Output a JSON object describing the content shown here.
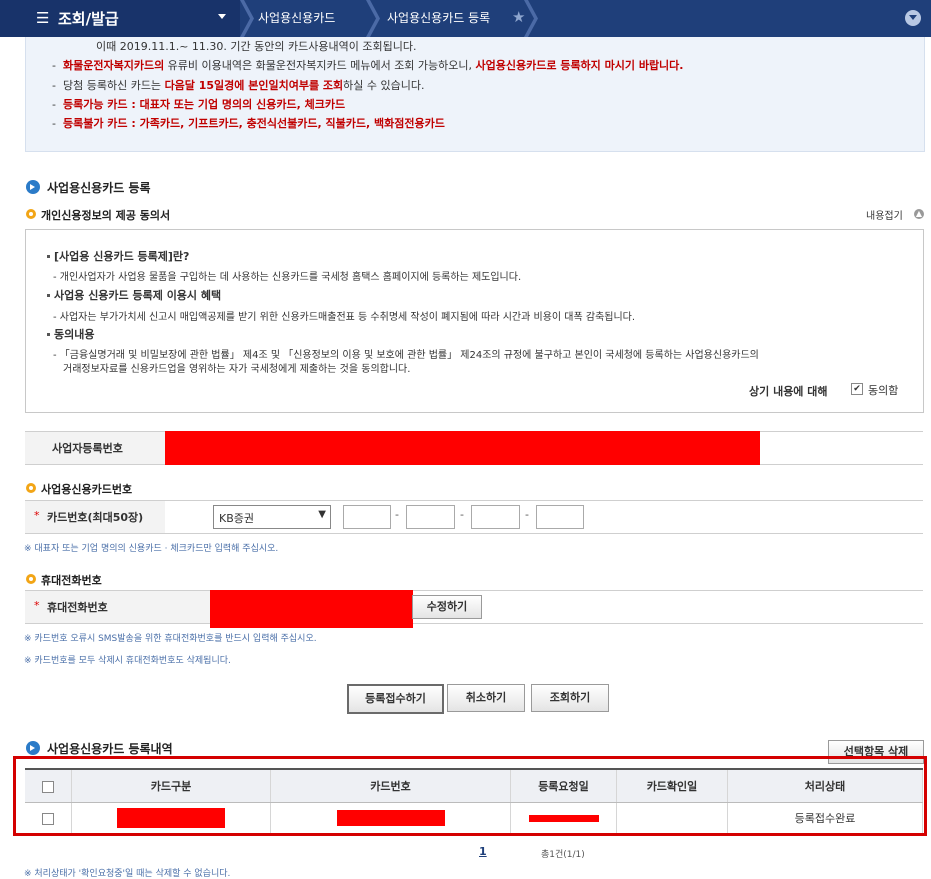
{
  "nav": {
    "menu_label": "조회/발급",
    "breadcrumb_1": "사업용신용카드",
    "breadcrumb_2": "사업용신용카드 등록",
    "star": "★"
  },
  "info": {
    "line0": "이때 2019.11.1.~ 11.30. 기간 동안의 카드사용내역이 조회됩니다.",
    "line1_red_a": "화물운전자복지카드의",
    "line1_mid": " 유류비 이용내역은 화물운전자복지카드 메뉴에서 조회 가능하오니, ",
    "line1_red_b": "사업용신용카드로 등록하지 마시기 바랍니다.",
    "line2_a": "당첨 등록하신 카드는 ",
    "line2_red": "다음달 15일경에 본인일치여부를 조회",
    "line2_b": "하실 수 있습니다.",
    "line3": "등록가능 카드 : 대표자 또는 기업 명의의 신용카드, 체크카드",
    "line4": "등록불가 카드 : 가족카드, 기프트카드, 충전식선불카드, 직불카드, 백화점전용카드",
    "dash": "-"
  },
  "register": {
    "section_title": "사업용신용카드 등록",
    "consent_title": "개인신용정보의 제공 동의서",
    "collapse_label": "내용접기",
    "h1": "[사업용 신용카드 등록제]란?",
    "p1": "- 개인사업자가 사업용 물품을 구입하는 데 사용하는 신용카드를 국세청 홈택스 홈페이지에 등록하는 제도입니다.",
    "h2": "사업용 신용카드 등록제 이용시 혜택",
    "p2": "- 사업자는 부가가치세 신고시 매입액공제를 받기 위한 신용카드매출전표 등 수취명세 작성이 폐지됨에 따라 시간과 비용이 대폭 감축됩니다.",
    "h3": "동의내용",
    "p3a": "- 「금융실명거래 및 비밀보장에 관한 법률」 제4조 및 「신용정보의 이용 및 보호에 관한 법률」 제24조의 규정에 불구하고 본인이 국세청에 등록하는 사업용신용카드의",
    "p3b": "거래정보자료를 신용카드업을 영위하는 자가 국세청에게 제출하는 것을 동의합니다.",
    "agree_prefix": "상기 내용에 대해",
    "agree_label": "동의함"
  },
  "form": {
    "bizno_label": "사업자등록번호",
    "card_section": "사업용신용카드번호",
    "card_label": "카드번호(최대50장)",
    "card_company": "KB증권",
    "card_note": "※ 대표자 또는 기업 명의의 신용카드 · 체크카드만 입력해 주십시오.",
    "phone_section": "휴대전화번호",
    "phone_label": "휴대전화번호",
    "edit_button": "수정하기",
    "phone_note1": "※ 카드번호 오류시 SMS발송을 위한 휴대전화번호를 반드시 입력해 주십시오.",
    "phone_note2": "※ 카드번호를 모두 삭제시 휴대전화번호도 삭제됩니다.",
    "asterisk": "*",
    "dash": "-"
  },
  "buttons": {
    "submit": "등록접수하기",
    "cancel": "취소하기",
    "search": "조회하기"
  },
  "list": {
    "section_title": "사업용신용카드 등록내역",
    "delete_button": "선택항목 삭제",
    "headers": [
      "카드구분",
      "카드번호",
      "등록요청일",
      "카드확인일",
      "처리상태"
    ],
    "row_status": "등록접수완료",
    "page": "1",
    "total": "총1건(1/1)",
    "footnote": "※ 처리상태가 '확인요청중'일 때는 삭제할 수 없습니다."
  },
  "colors": {
    "nav": "#1f3f7a",
    "redact": "#ff0000",
    "highlight": "#d40000"
  }
}
